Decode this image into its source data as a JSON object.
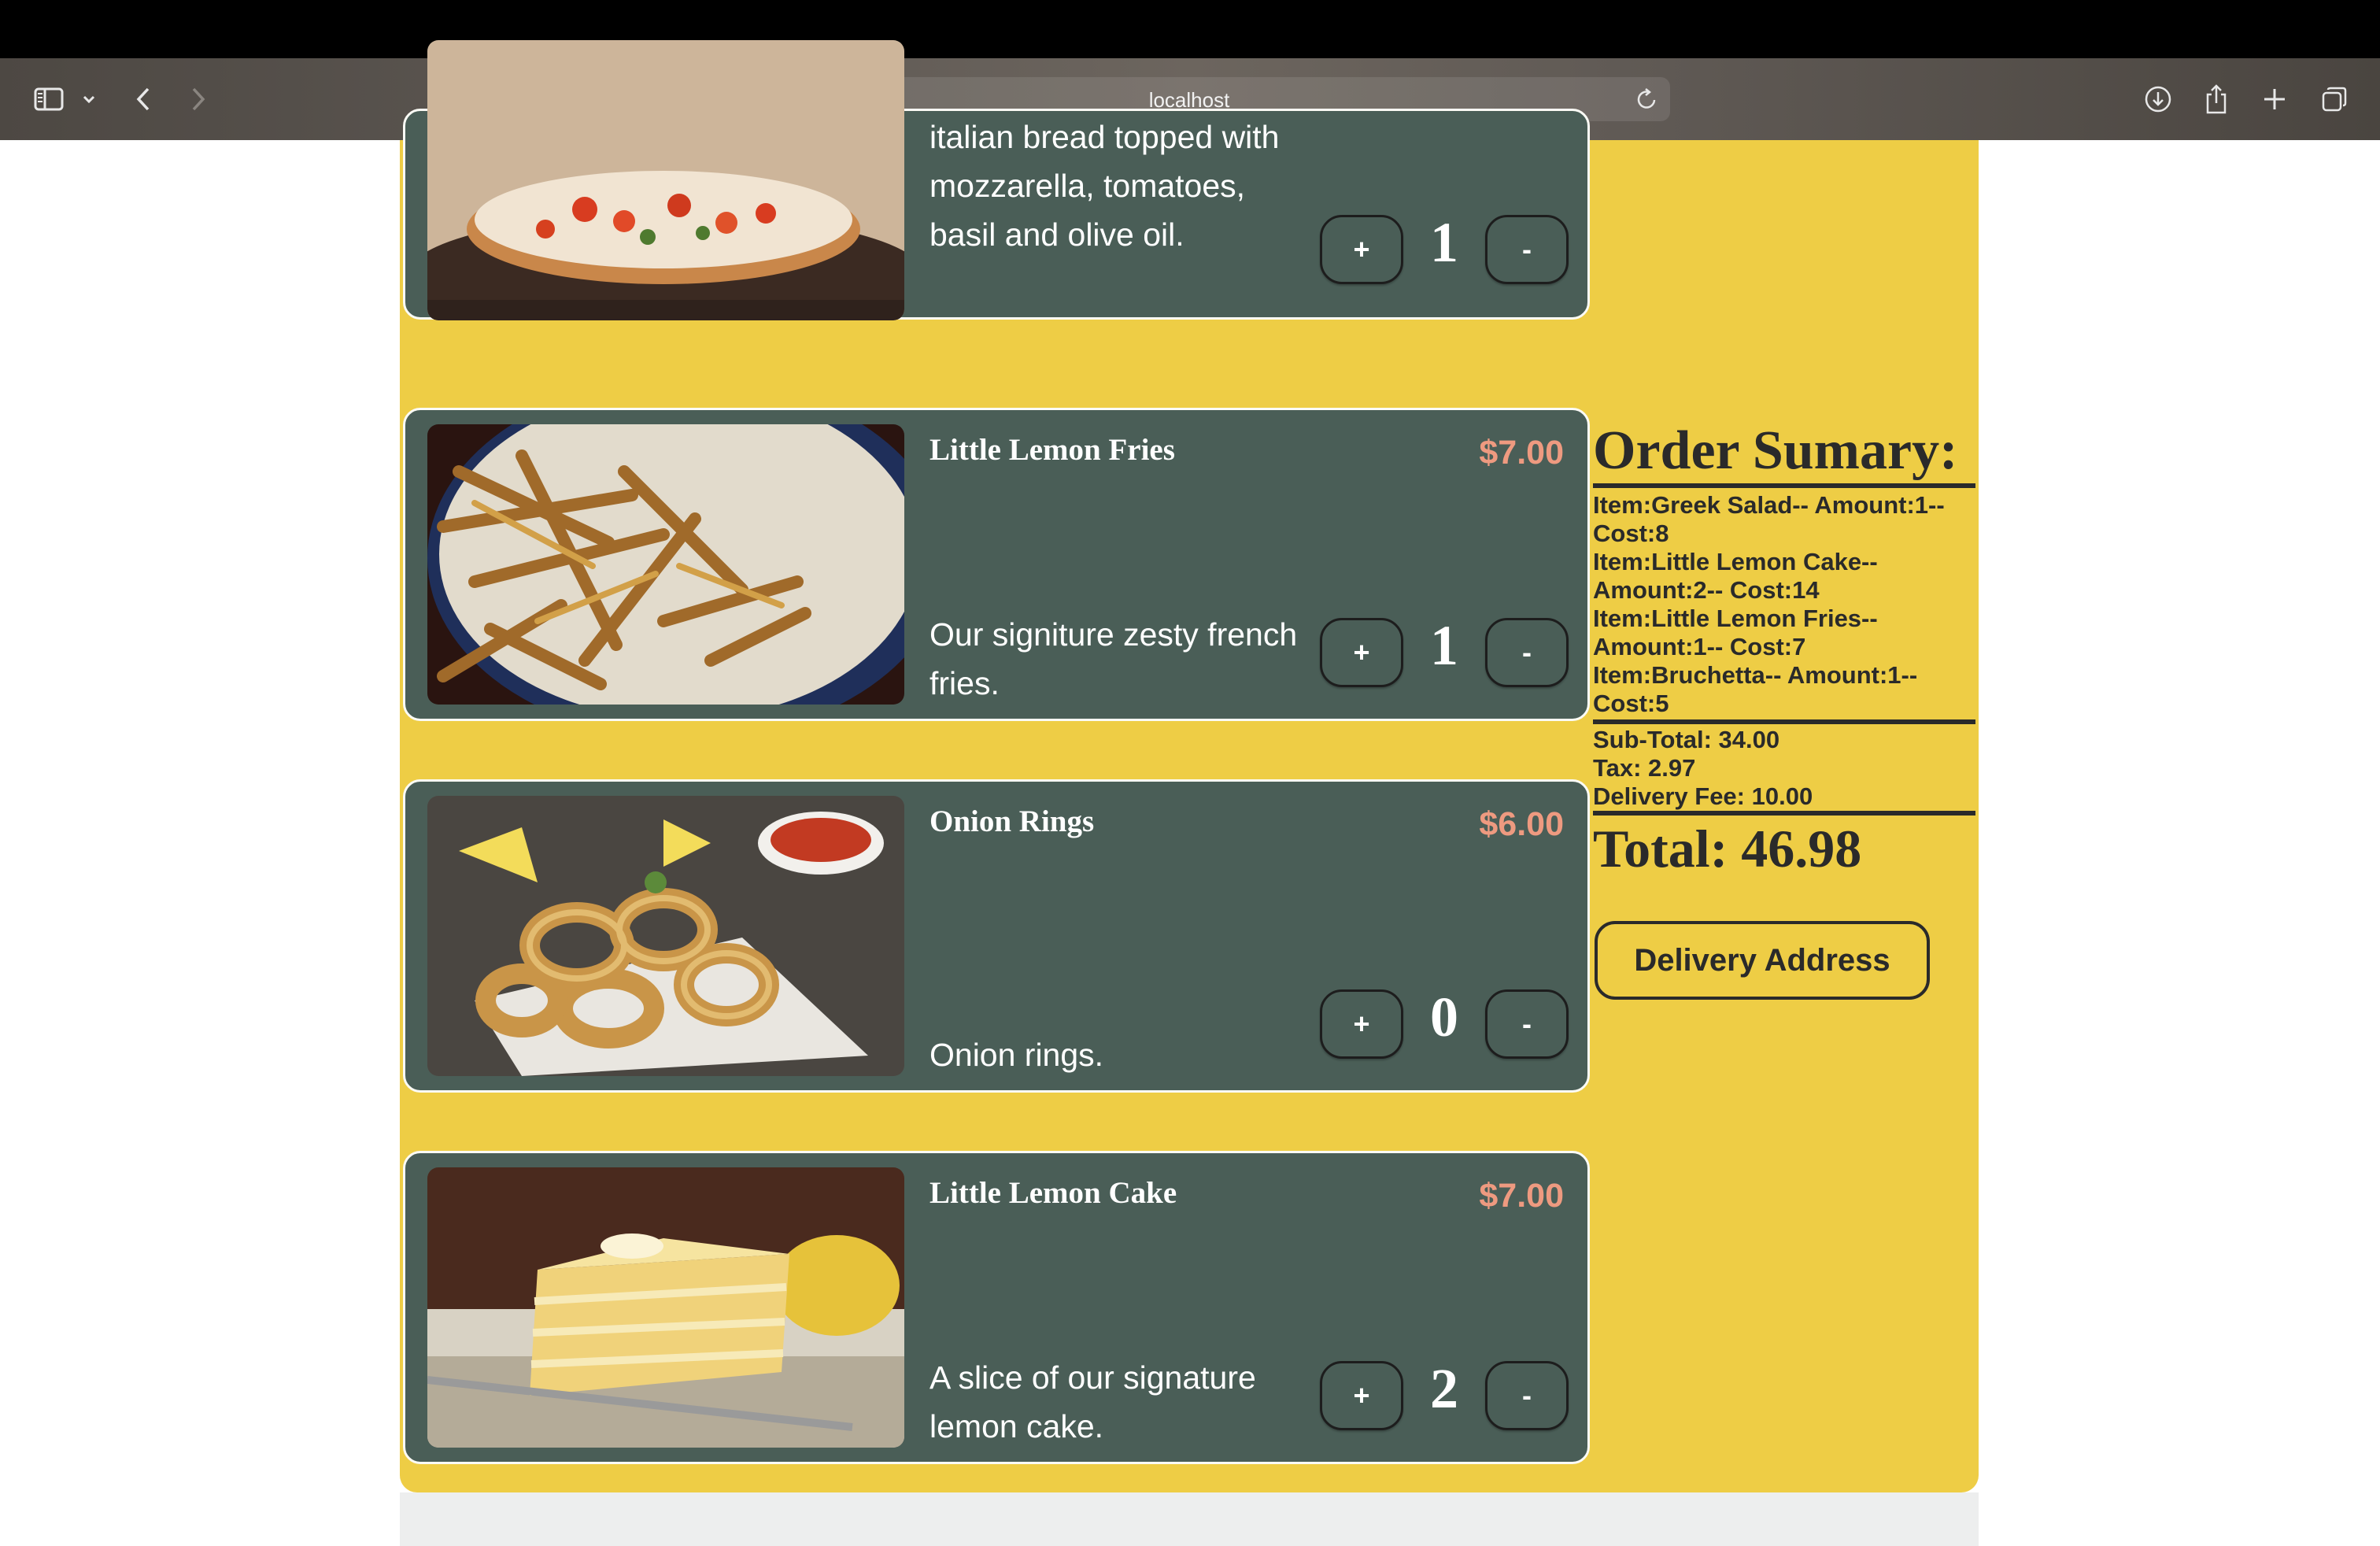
{
  "browser": {
    "url": "localhost"
  },
  "menu": {
    "items": [
      {
        "name": "",
        "price": "",
        "description": "italian bread topped with mozzarella, tomatoes, basil and olive oil.",
        "quantity": "1",
        "plus_label": "+",
        "minus_label": "-"
      },
      {
        "name": "Little Lemon Fries",
        "price": "$7.00",
        "description": "Our signiture zesty french fries.",
        "quantity": "1",
        "plus_label": "+",
        "minus_label": "-"
      },
      {
        "name": "Onion Rings",
        "price": "$6.00",
        "description": "Onion rings.",
        "quantity": "0",
        "plus_label": "+",
        "minus_label": "-"
      },
      {
        "name": "Little Lemon Cake",
        "price": "$7.00",
        "description": "A slice of our signature lemon cake.",
        "quantity": "2",
        "plus_label": "+",
        "minus_label": "-"
      }
    ]
  },
  "summary": {
    "title": "Order Sumary:",
    "lines": [
      "Item:Greek Salad-- Amount:1-- Cost:8",
      "Item:Little Lemon Cake-- Amount:2-- Cost:14",
      "Item:Little Lemon Fries-- Amount:1-- Cost:7",
      "Item:Bruchetta-- Amount:1-- Cost:5"
    ],
    "subtotal": "Sub-Total: 34.00",
    "tax": "Tax: 2.97",
    "delivery_fee": "Delivery Fee: 10.00",
    "total": "Total: 46.98",
    "delivery_button": "Delivery Address"
  },
  "colors": {
    "page_background": "#eecd45",
    "card_background": "#4a5e57",
    "price": "#ee9a80",
    "text_dark": "#2a2a2a"
  }
}
